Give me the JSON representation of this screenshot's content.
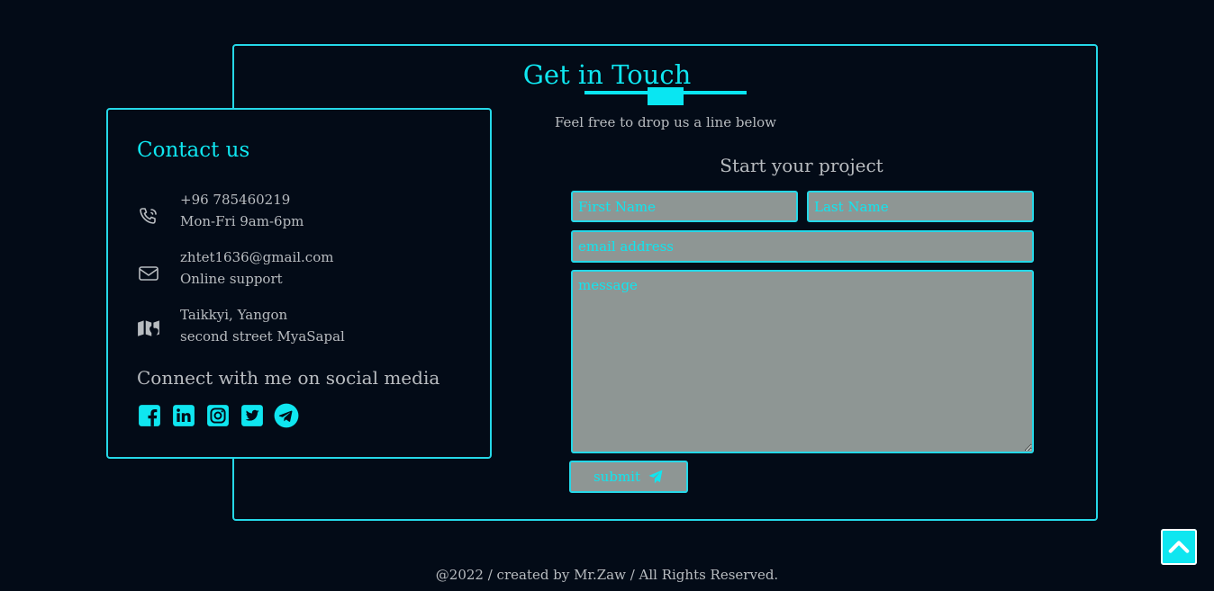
{
  "header": {
    "title": "Get in Touch",
    "subtitle": "Feel free to drop us a line below"
  },
  "contact": {
    "title": "Contact us",
    "phone": {
      "line1": "+96 785460219",
      "line2": "Mon-Fri 9am-6pm",
      "icon": "phone-icon"
    },
    "email": {
      "line1": "zhtet1636@gmail.com",
      "line2": "Online support",
      "icon": "mail-icon"
    },
    "address": {
      "line1": "Taikkyi, Yangon",
      "line2": "second street MyaSapal",
      "icon": "map-icon"
    },
    "social_heading": "Connect with me on social media",
    "social_icons": [
      "facebook-icon",
      "linkedin-icon",
      "instagram-icon",
      "twitter-icon",
      "telegram-icon"
    ]
  },
  "form": {
    "heading": "Start your project",
    "first_name_placeholder": "First Name",
    "last_name_placeholder": "Last Name",
    "email_placeholder": "email address",
    "message_placeholder": "message",
    "submit_label": "submit"
  },
  "footer": {
    "text": "@2022 / created by Mr.Zaw / All Rights Reserved."
  },
  "colors": {
    "background": "#030b17",
    "accent": "#0fe6f0",
    "border": "#25d8e8",
    "text": "#b8bcc0",
    "field_bg": "#8e9694"
  }
}
